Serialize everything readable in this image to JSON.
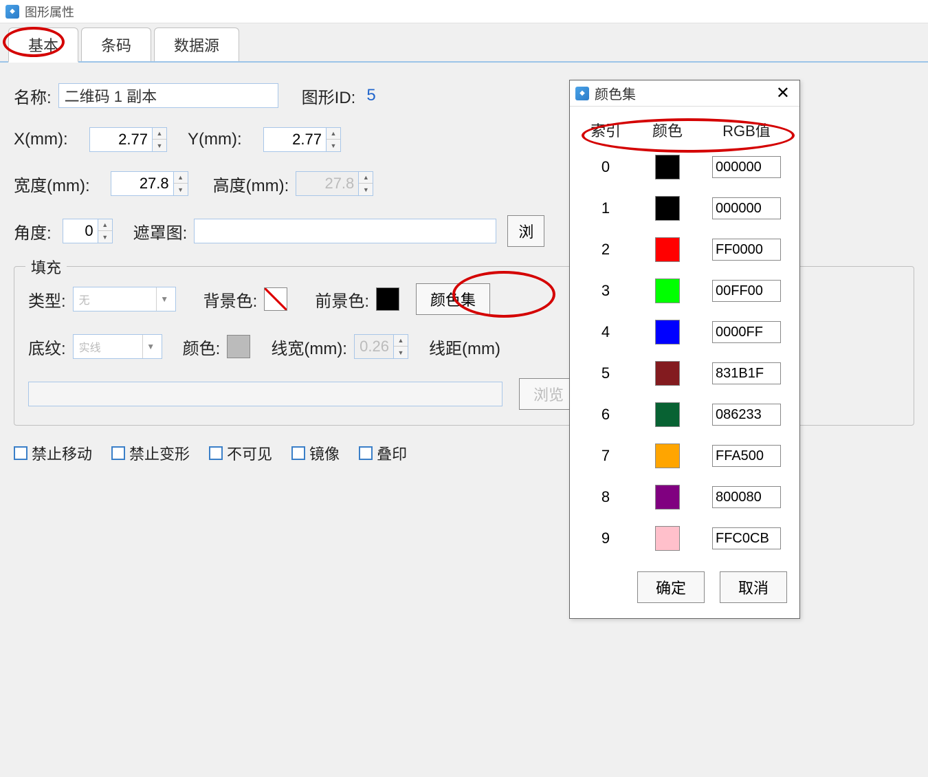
{
  "window": {
    "title": "图形属性"
  },
  "tabs": {
    "basic": "基本",
    "barcode": "条码",
    "datasource": "数据源"
  },
  "fields": {
    "name_label": "名称:",
    "name_value": "二维码 1 副本",
    "shapeid_label": "图形ID:",
    "shapeid_value": "5",
    "x_label": "X(mm):",
    "x_value": "2.77",
    "y_label": "Y(mm):",
    "y_value": "2.77",
    "width_label": "宽度(mm):",
    "width_value": "27.8",
    "height_label": "高度(mm):",
    "height_value": "27.8",
    "angle_label": "角度:",
    "angle_value": "0",
    "mask_label": "遮罩图:",
    "browse": "浏",
    "fill_legend": "填充",
    "type_label": "类型:",
    "type_value": "无",
    "bgcolor_label": "背景色:",
    "fgcolor_label": "前景色:",
    "colorset_btn": "颜色集",
    "hatch_label": "底纹:",
    "hatch_value": "实线",
    "color_label": "颜色:",
    "linewidth_label": "线宽(mm):",
    "linewidth_value": "0.26",
    "linegap_label": "线距(mm)",
    "browse2": "浏览"
  },
  "checks": {
    "no_move": "禁止移动",
    "no_resize": "禁止变形",
    "invisible": "不可见",
    "mirror": "镜像",
    "overprint": "叠印"
  },
  "popup": {
    "title": "颜色集",
    "head_index": "索引",
    "head_color": "颜色",
    "head_rgb": "RGB值",
    "rows": [
      {
        "idx": "0",
        "hex": "000000",
        "color": "#000000"
      },
      {
        "idx": "1",
        "hex": "000000",
        "color": "#000000"
      },
      {
        "idx": "2",
        "hex": "FF0000",
        "color": "#FF0000"
      },
      {
        "idx": "3",
        "hex": "00FF00",
        "color": "#00FF00"
      },
      {
        "idx": "4",
        "hex": "0000FF",
        "color": "#0000FF"
      },
      {
        "idx": "5",
        "hex": "831B1F",
        "color": "#831B1F"
      },
      {
        "idx": "6",
        "hex": "086233",
        "color": "#086233"
      },
      {
        "idx": "7",
        "hex": "FFA500",
        "color": "#FFA500"
      },
      {
        "idx": "8",
        "hex": "800080",
        "color": "#800080"
      },
      {
        "idx": "9",
        "hex": "FFC0CB",
        "color": "#FFC0CB"
      }
    ],
    "ok": "确定",
    "cancel": "取消"
  }
}
